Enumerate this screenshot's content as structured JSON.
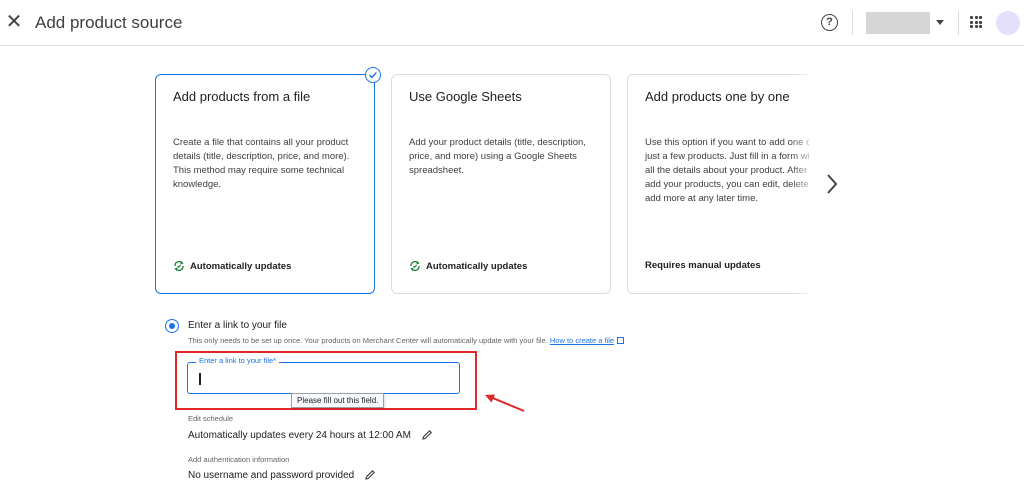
{
  "header": {
    "title": "Add product source",
    "close_icon": "close-icon",
    "help_icon": "help-icon",
    "apps_icon": "apps-grid-icon"
  },
  "cards": [
    {
      "title": "Add products from a file",
      "description": "Create a file that contains all your product details (title, description, price, and more). This method may require some technical knowledge.",
      "footer": "Automatically updates",
      "selected": true
    },
    {
      "title": "Use Google Sheets",
      "description": "Add your product details (title, description, price, and more) using a Google Sheets spreadsheet.",
      "footer": "Automatically updates",
      "selected": false
    },
    {
      "title": "Add products one by one",
      "description": "Use this option if you want to add one or just a few products. Just fill in a form with all the details about your product. After you add your products, you can edit, delete or add more at any later time.",
      "footer": "Requires manual updates",
      "selected": false
    }
  ],
  "link_option": {
    "label": "Enter a link to your file",
    "help_text": "This only needs to be set up once. Your products on Merchant Center will automatically update with your file.",
    "help_link": "How to create a file",
    "field_label": "Enter a link to your file*",
    "field_value": "",
    "tooltip": "Please fill out this field."
  },
  "schedule": {
    "label": "Edit schedule",
    "value": "Automatically updates every 24 hours at 12:00 AM"
  },
  "authentication": {
    "label": "Add authentication information",
    "value": "No username and password provided"
  },
  "colors": {
    "accent": "#1a73e8",
    "annotation_red": "#e2262a",
    "success_green": "#188038"
  }
}
